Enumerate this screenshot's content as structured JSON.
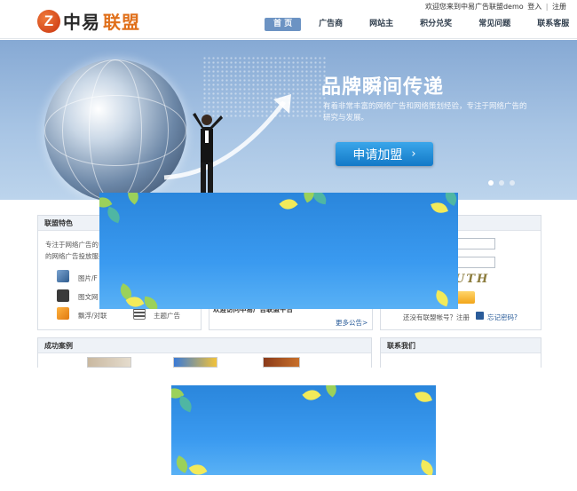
{
  "header": {
    "logo_mark": "Z",
    "logo_text_a": "中易",
    "logo_text_b": "联盟",
    "welcome": "欢迎您来到中易广告联盟demo",
    "login": "登入",
    "sep": "|",
    "register": "注册",
    "nav": [
      "首 页",
      "广告商",
      "网站主",
      "积分兑奖",
      "常见问题",
      "联系客服"
    ]
  },
  "banner": {
    "headline": "品牌瞬间传递",
    "subtext": "有着非常丰富的网络广告和网络策划经验，专注于网络广告的研究与发展。",
    "button": "申请加盟",
    "button_icon": "chevron-right-icon",
    "slides_count": 3,
    "active_slide": 1
  },
  "features": {
    "title": "联盟特色",
    "intro_1": "专注于网络广告的",
    "intro_2": "的网络广告投放服务",
    "items": [
      "图片/F",
      "图文网",
      "飘浮/对联",
      "主题广告"
    ]
  },
  "notice": {
    "text": "欢迎访问中易广告联盟平台",
    "more": "更多公告>"
  },
  "login": {
    "captcha": "UTH",
    "no_account": "还没有联盟帐号？注册",
    "forgot": "忘记密码?"
  },
  "cases": {
    "title": "成功案例"
  },
  "contact": {
    "title": "联系我们"
  },
  "colors": {
    "nav_active": "#6c93c3",
    "brand_orange": "#e0701b",
    "apply_button": "#1f8ad6",
    "overlay_blue": "#3a9af0"
  }
}
